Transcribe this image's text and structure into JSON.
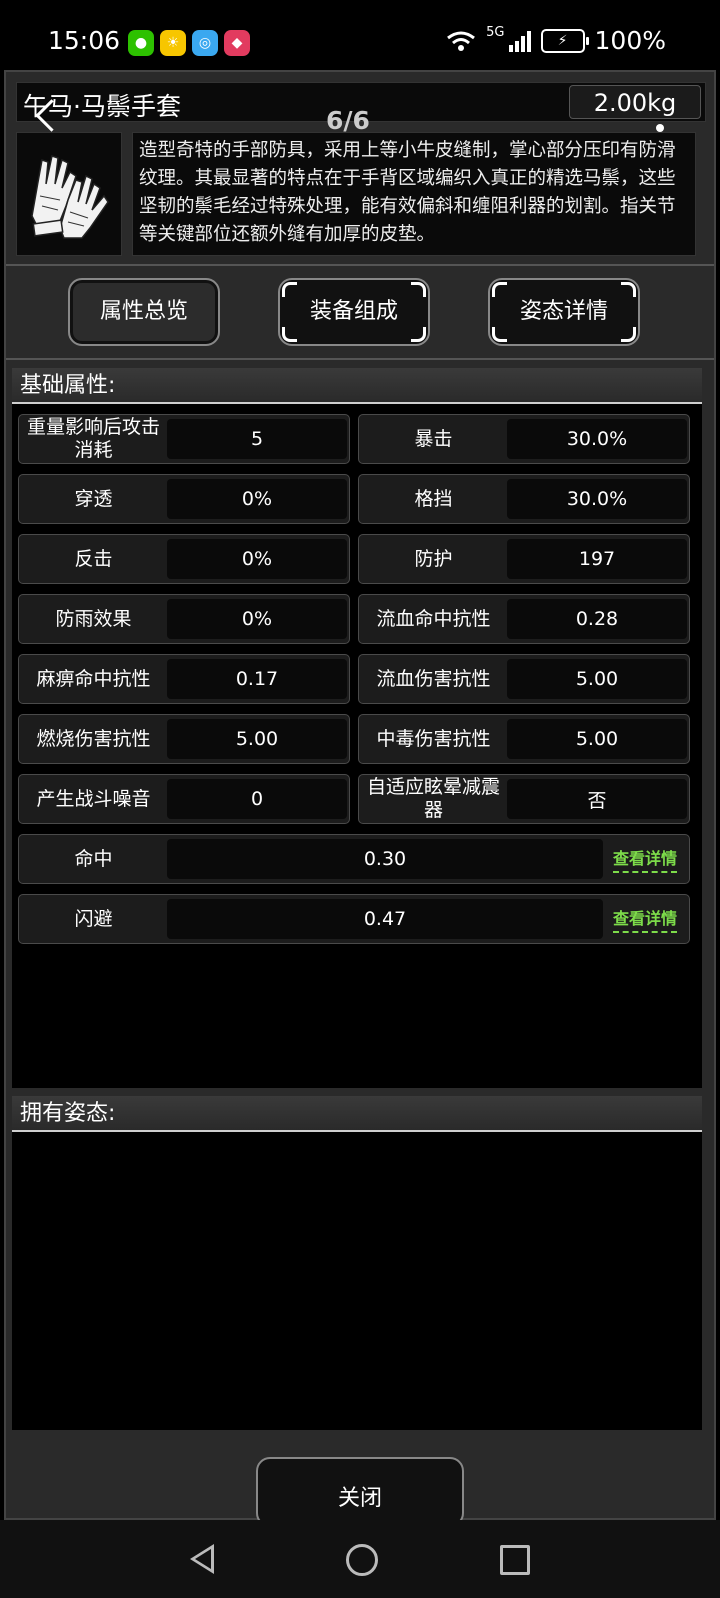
{
  "status_bar": {
    "time": "15:06",
    "network": "5G",
    "battery": "100%",
    "app_icons": [
      "wechat-icon",
      "weather-icon",
      "app-icon",
      "mobile-icon"
    ]
  },
  "item": {
    "name": "午马·马鬃手套",
    "weight": "2.00kg",
    "pager": "6/6",
    "description": "造型奇特的手部防具，采用上等小牛皮缝制，掌心部分压印有防滑纹理。其最显著的特点在于手背区域编织入真正的精选马鬃，这些坚韧的鬃毛经过特殊处理，能有效偏斜和缠阻利器的划割。指关节等关键部位还额外缝有加厚的皮垫。",
    "icon": "gloves-icon"
  },
  "tabs": [
    {
      "label": "属性总览",
      "active": true
    },
    {
      "label": "装备组成",
      "active": false
    },
    {
      "label": "姿态详情",
      "active": false
    }
  ],
  "basic": {
    "title": "基础属性:",
    "stats": [
      {
        "label": "重量影响后攻击消耗",
        "value": "5"
      },
      {
        "label": "暴击",
        "value": "30.0%"
      },
      {
        "label": "穿透",
        "value": "0%"
      },
      {
        "label": "格挡",
        "value": "30.0%"
      },
      {
        "label": "反击",
        "value": "0%"
      },
      {
        "label": "防护",
        "value": "197"
      },
      {
        "label": "防雨效果",
        "value": "0%"
      },
      {
        "label": "流血命中抗性",
        "value": "0.28"
      },
      {
        "label": "麻痹命中抗性",
        "value": "0.17"
      },
      {
        "label": "流血伤害抗性",
        "value": "5.00"
      },
      {
        "label": "燃烧伤害抗性",
        "value": "5.00"
      },
      {
        "label": "中毒伤害抗性",
        "value": "5.00"
      },
      {
        "label": "产生战斗噪音",
        "value": "0"
      },
      {
        "label": "自适应眩晕减震器",
        "value": "否"
      }
    ],
    "wide_stats": [
      {
        "label": "命中",
        "value": "0.30",
        "link": "查看详情"
      },
      {
        "label": "闪避",
        "value": "0.47",
        "link": "查看详情"
      }
    ]
  },
  "postures": {
    "title": "拥有姿态:"
  },
  "close_label": "关闭",
  "colors": {
    "accent_link": "#7ddc4a",
    "panel": "#2a2a2a"
  }
}
